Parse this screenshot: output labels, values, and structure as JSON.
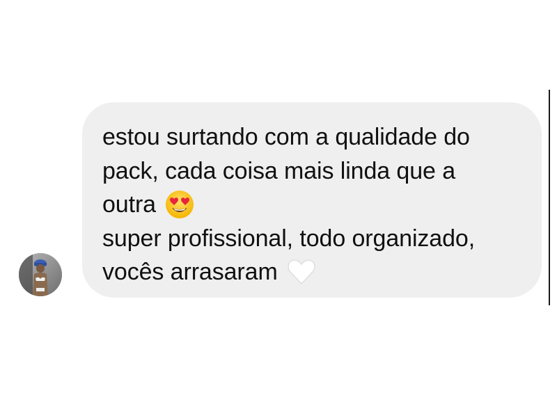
{
  "message": {
    "lines": [
      "estou surtando com a qualidade do",
      "pack, cada coisa mais linda que a",
      "outra",
      "super profissional, todo organizado,",
      "vocês arrasaram"
    ],
    "emojis": {
      "line3": "heart-eyes-emoji",
      "line5": "white-heart-emoji"
    }
  },
  "colors": {
    "bubble": "#efefef",
    "text": "#101010",
    "background": "#ffffff"
  }
}
